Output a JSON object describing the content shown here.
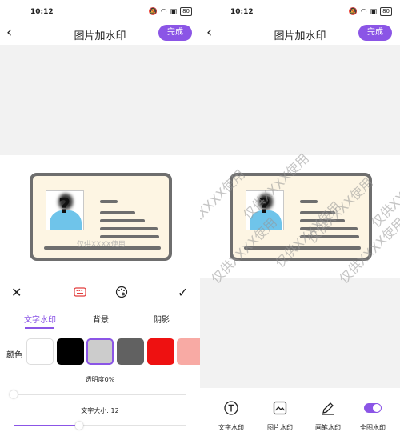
{
  "status": {
    "time": "10:12",
    "battery": "80"
  },
  "header": {
    "title": "图片加水印",
    "done_label": "完成",
    "back_icon": "back-icon"
  },
  "watermark": {
    "text": "仅供XXXX使用"
  },
  "panel": {
    "tabs": [
      "文字水印",
      "背景",
      "阴影"
    ],
    "color_label": "颜色",
    "colors": [
      "#ffffff",
      "#000000",
      "#cccccc",
      "#616161",
      "#ee1111",
      "#f8aaa4"
    ],
    "opacity_label": "透明度0%",
    "opacity_value": 0,
    "size_label": "文字大小: 12",
    "size_value": 12
  },
  "bottom": {
    "items": [
      "文字水印",
      "图片水印",
      "画笔水印",
      "全图水印"
    ]
  },
  "accent": "#8b55e6"
}
